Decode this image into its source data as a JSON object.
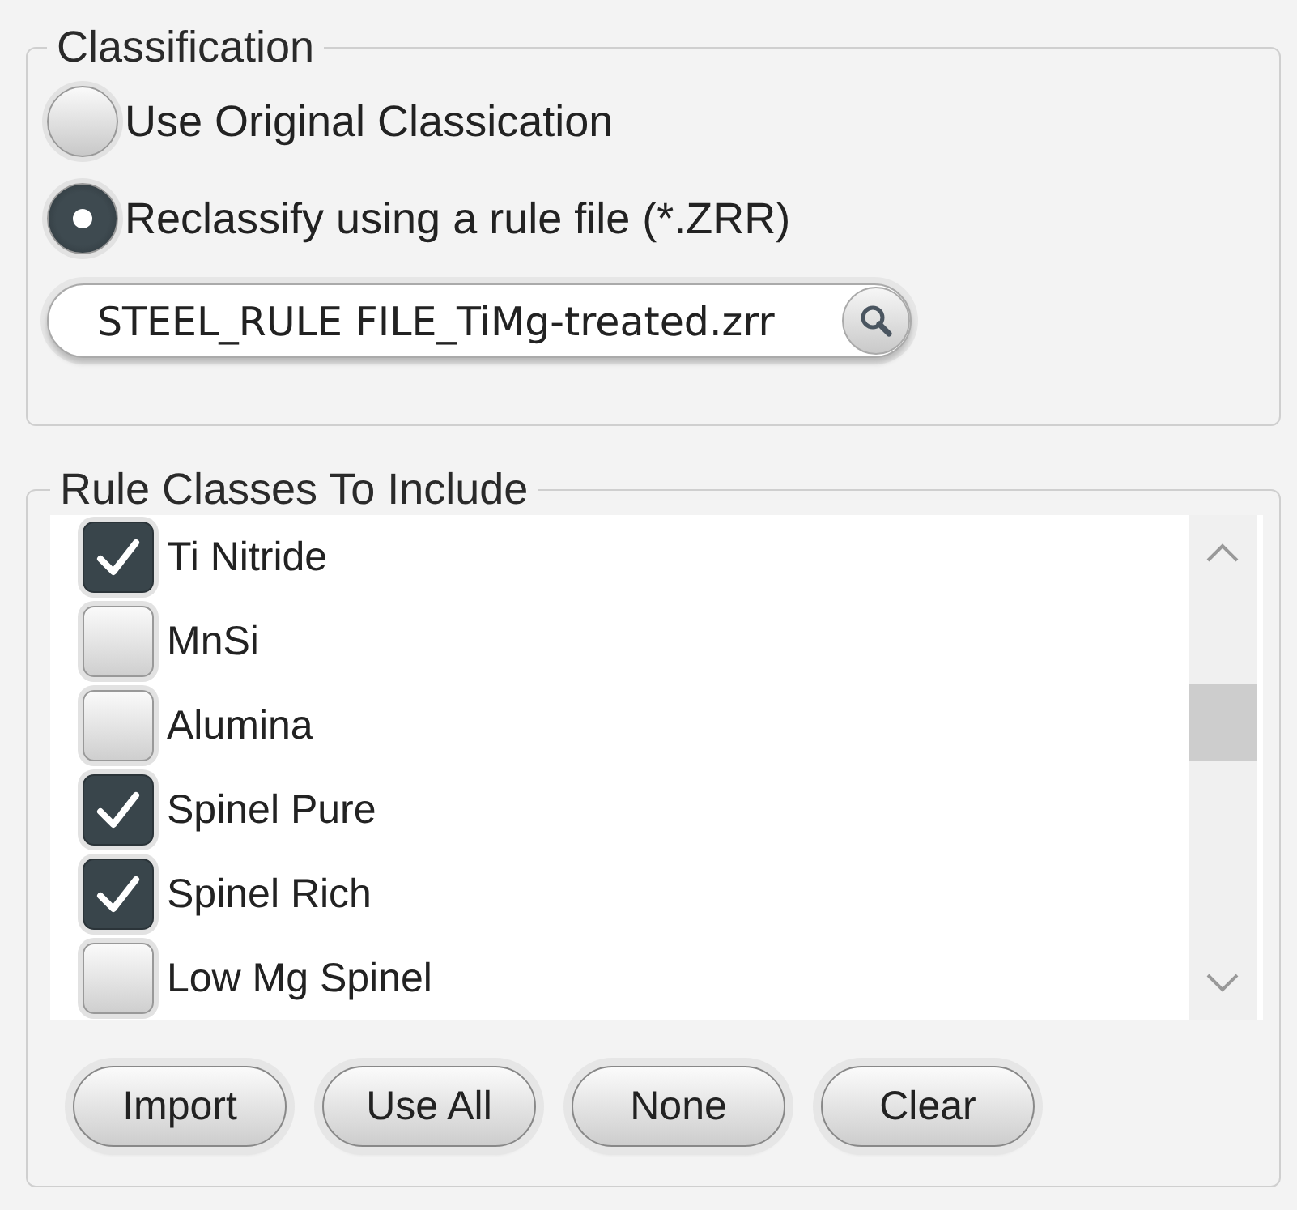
{
  "classification": {
    "legend": "Classification",
    "options": [
      {
        "label": "Use Original Classication",
        "selected": false
      },
      {
        "label": "Reclassify using a rule file (*.ZRR)",
        "selected": true
      }
    ],
    "file_field": {
      "value": "STEEL_RULE FILE_TiMg-treated.zrr"
    }
  },
  "rule_classes": {
    "legend": "Rule Classes To Include",
    "items": [
      {
        "label": "Ti Nitride",
        "checked": true
      },
      {
        "label": "MnSi",
        "checked": false
      },
      {
        "label": "Alumina",
        "checked": false
      },
      {
        "label": "Spinel Pure",
        "checked": true
      },
      {
        "label": "Spinel Rich",
        "checked": true
      },
      {
        "label": "Low Mg Spinel",
        "checked": false
      }
    ],
    "buttons": [
      "Import",
      "Use All",
      "None",
      "Clear"
    ]
  }
}
